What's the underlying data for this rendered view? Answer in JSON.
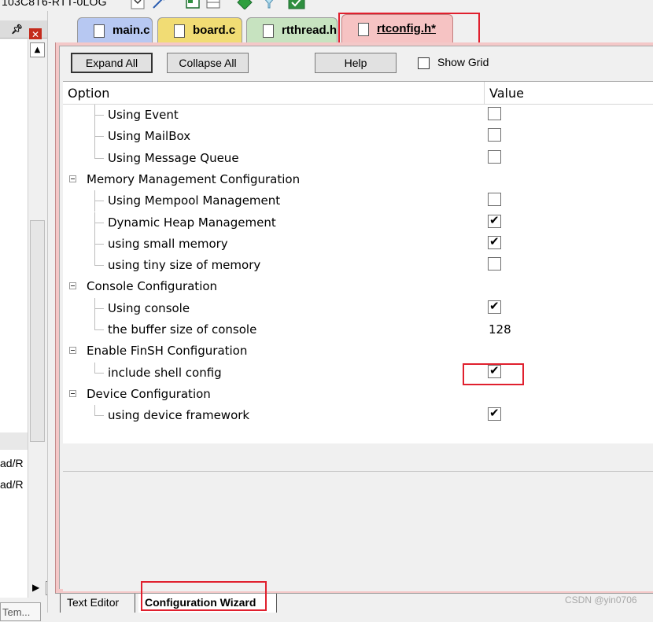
{
  "project_label": "103C8T6-RTT-0LOG",
  "left_panel": {
    "text_lines": [
      "ad/R",
      "ad/R"
    ],
    "bottom_tab": "Tem..."
  },
  "tabs": [
    {
      "label": "main.c",
      "color": "#b7c8f2"
    },
    {
      "label": "board.c",
      "color": "#f1dc74"
    },
    {
      "label": "rtthread.h",
      "color": "#c7e3c0"
    },
    {
      "label": "rtconfig.h*",
      "color": "#f6c3c3",
      "active": true
    }
  ],
  "toolbar": {
    "expand_all": "Expand All",
    "collapse_all": "Collapse All",
    "help": "Help",
    "show_grid": "Show Grid"
  },
  "grid": {
    "header_option": "Option",
    "header_value": "Value",
    "rows": [
      {
        "label": "Using Event",
        "kind": "child",
        "checked": false
      },
      {
        "label": "Using MailBox",
        "kind": "child",
        "checked": false
      },
      {
        "label": "Using Message Queue",
        "kind": "child",
        "checked": false
      },
      {
        "label": "Memory Management Configuration",
        "kind": "group"
      },
      {
        "label": "Using Mempool Management",
        "kind": "child",
        "checked": false
      },
      {
        "label": "Dynamic Heap Management",
        "kind": "child",
        "checked": true
      },
      {
        "label": "using small memory",
        "kind": "child",
        "checked": true
      },
      {
        "label": "using tiny size of memory",
        "kind": "child",
        "checked": false
      },
      {
        "label": "Console Configuration",
        "kind": "group"
      },
      {
        "label": "Using console",
        "kind": "child",
        "checked": true
      },
      {
        "label": "the buffer size of console",
        "kind": "child",
        "value": "128"
      },
      {
        "label": "Enable FinSH Configuration",
        "kind": "group"
      },
      {
        "label": "include shell config",
        "kind": "child",
        "checked": true
      },
      {
        "label": "Device Configuration",
        "kind": "group"
      },
      {
        "label": "using device framework",
        "kind": "child",
        "checked": true
      }
    ]
  },
  "bottom_tabs": {
    "text_editor": "Text Editor",
    "config_wizard": "Configuration Wizard"
  },
  "watermark": "CSDN @yin0706",
  "colors": {
    "highlight_red": "#e0202e",
    "wizard_frame": "#f4c8c8"
  }
}
